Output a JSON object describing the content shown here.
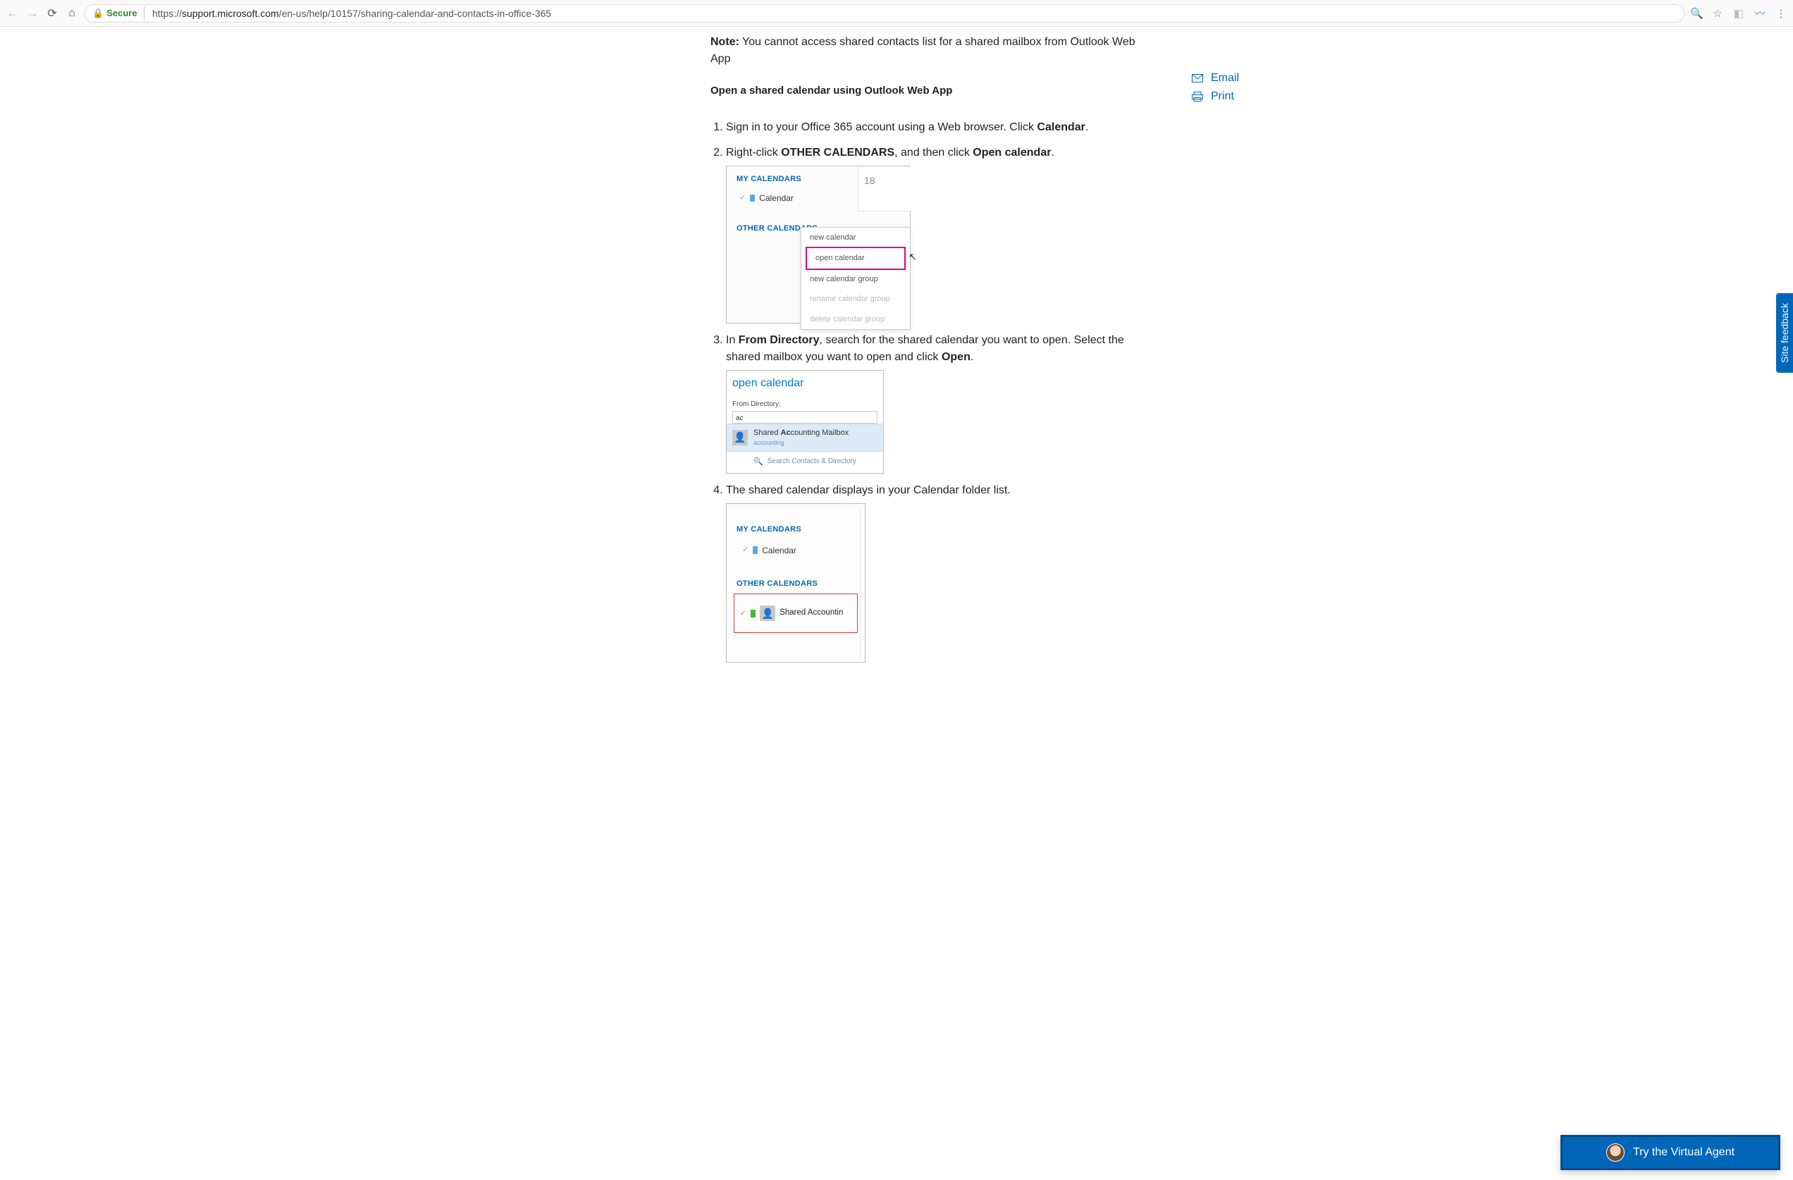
{
  "browser": {
    "secure_label": "Secure",
    "url_prefix": "https://",
    "url_domain": "support.microsoft.com",
    "url_path": "/en-us/help/10157/sharing-calendar-and-contacts-in-office-365"
  },
  "note": {
    "label": "Note:",
    "text": " You cannot access shared contacts list for a shared mailbox from Outlook Web App"
  },
  "section_heading": "Open a shared calendar using Outlook Web App",
  "steps": {
    "s1_pre": "Sign in to your Office 365 account using a Web browser. Click ",
    "s1_bold": "Calendar",
    "s1_post": ".",
    "s2_pre": "Right-click ",
    "s2_bold1": "OTHER CALENDARS",
    "s2_mid": ", and then click ",
    "s2_bold2": "Open calendar",
    "s2_post": ".",
    "s3_pre": "In ",
    "s3_bold1": "From Directory",
    "s3_mid": ", search for the shared calendar you want to open. Select the shared mailbox you want to open and click ",
    "s3_bold2": "Open",
    "s3_post": ".",
    "s4": "The shared calendar displays in your Calendar folder list."
  },
  "shot1": {
    "my_calendars": "MY CALENDARS",
    "calendar": "Calendar",
    "date": "18",
    "other_calendars": "OTHER CALENDARS",
    "ctx": {
      "new_calendar": "new calendar",
      "open_calendar": "open calendar",
      "new_group": "new calendar group",
      "rename_group": "rename calendar group",
      "delete_group": "delete calendar group"
    }
  },
  "shot2": {
    "title": "open calendar",
    "from_directory": "From Directory:",
    "input_value": "ac",
    "result_pre": "Shared ",
    "result_bold": "Ac",
    "result_post": "counting Mailbox",
    "result_sub": "accounting",
    "search_contacts": "Search Contacts & Directory"
  },
  "shot3": {
    "my_calendars": "MY CALENDARS",
    "calendar": "Calendar",
    "other_calendars": "OTHER CALENDARS",
    "shared_name": "Shared Accountin"
  },
  "side": {
    "email": "Email",
    "print": "Print"
  },
  "site_feedback": "Site feedback",
  "virtual_agent": "Try the Virtual Agent"
}
